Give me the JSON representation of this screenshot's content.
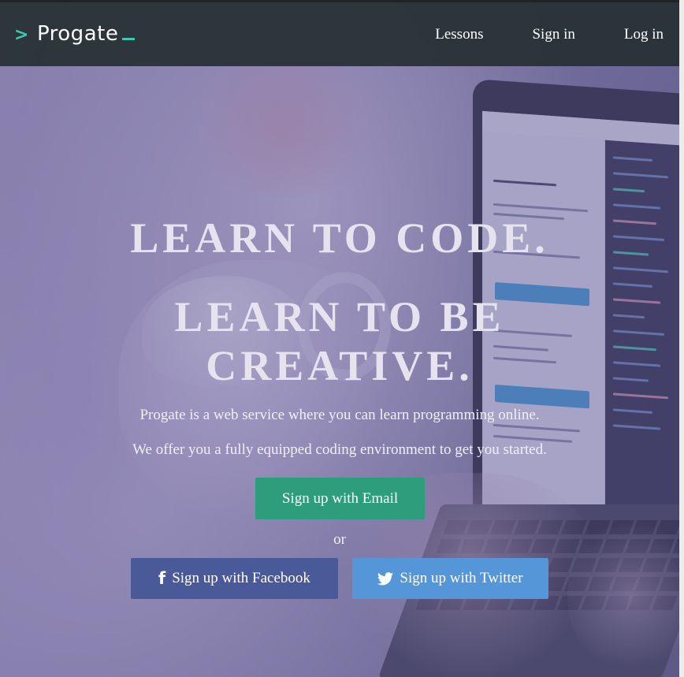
{
  "header": {
    "logo_chevron": ">",
    "logo_text": "Progate",
    "nav": {
      "lessons": "Lessons",
      "sign_in": "Sign in",
      "log_in": "Log in"
    }
  },
  "hero": {
    "headline_1": "LEARN TO CODE.",
    "headline_2_line_1": "LEARN TO BE",
    "headline_2_line_2": "CREATIVE.",
    "tagline_1": "Progate is a web service where you can learn programming online.",
    "tagline_2": "We offer you a fully equipped coding environment to get you started.",
    "signup_email": "Sign up with Email",
    "or": "or",
    "signup_facebook": "Sign up with Facebook",
    "signup_twitter": "Sign up with Twitter",
    "facebook_glyph": "f"
  },
  "icons": {
    "logo": "chevron-right-icon",
    "facebook": "facebook-icon",
    "twitter": "twitter-icon"
  },
  "colors": {
    "accent_teal": "#3dcbb0",
    "header_bg": "#263134",
    "email_button": "#2e9d7c",
    "facebook_button": "#4a5a99",
    "twitter_button": "#5596d8",
    "overlay": "#5e5696"
  }
}
